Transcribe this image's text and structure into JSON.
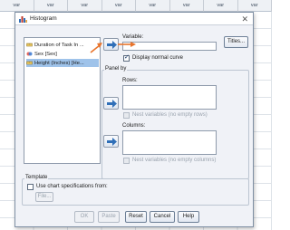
{
  "spreadsheet": {
    "columns": [
      "var",
      "var",
      "var",
      "var",
      "var",
      "var",
      "var",
      "var"
    ]
  },
  "dialog": {
    "title": "Histogram",
    "close_glyph": "✕",
    "variables": [
      {
        "label": "Duration of Task In ...",
        "icon": "scale-ruler-icon"
      },
      {
        "label": "Sex [Sex]",
        "icon": "nominal-venn-icon"
      },
      {
        "label": "Height (Inches) [He...",
        "icon": "scale-ruler-icon"
      }
    ],
    "variable_label": "Variable:",
    "variable_value": "",
    "display_normal_curve_label": "Display normal curve",
    "display_normal_curve_checked": true,
    "titles_label": "Titles...",
    "panel_by_label": "Panel by",
    "rows_label": "Rows:",
    "rows_nest_label": "Nest variables (no empty rows)",
    "columns_label": "Columns:",
    "columns_nest_label": "Nest variables (no empty columns)",
    "template_label": "Template",
    "use_chart_spec_label": "Use chart specifications from:",
    "file_button_label": "File...",
    "buttons": {
      "ok": "OK",
      "paste": "Paste",
      "reset": "Reset",
      "cancel": "Cancel",
      "help": "Help"
    }
  },
  "colors": {
    "accent": "#2f6fb8",
    "annotation_arrow": "#e8742c",
    "selection": "#9fc3ea"
  }
}
